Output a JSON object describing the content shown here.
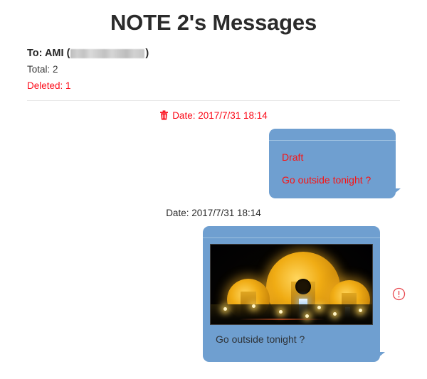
{
  "page": {
    "title": "NOTE 2's Messages"
  },
  "meta": {
    "to_prefix": "To: AMI (",
    "to_suffix": ")",
    "recipient_name": "AMI",
    "recipient_number_redacted": true,
    "total_label": "Total: 2",
    "deleted_label": "Deleted: 1",
    "deleted_color": "#fc0d1b"
  },
  "messages": [
    {
      "id": "message-1",
      "deleted": true,
      "date_text": "Date: 2017/7/31 18:14",
      "date_color": "#fb0a18",
      "trash_icon": "trash-icon",
      "bubble_color": "#6f9fd0",
      "draft_label": "Draft",
      "body_text": "Go outside tonight ?",
      "body_color": "#fb1212",
      "has_attachment": false,
      "has_alert": false
    },
    {
      "id": "message-2",
      "deleted": false,
      "date_text": "Date: 2017/7/31 18:14",
      "date_color": "#2b2b2b",
      "bubble_color": "#6f9fd0",
      "body_text": "Go outside tonight ?",
      "body_color": "#2e3338",
      "has_attachment": true,
      "attachment_name": "night-scene-photo",
      "attachment_description": "Night photograph of three illuminated golden dome structures with street lamps",
      "has_alert": true,
      "alert_icon": "exclamation-circle-icon",
      "alert_color": "#e8484f"
    }
  ]
}
